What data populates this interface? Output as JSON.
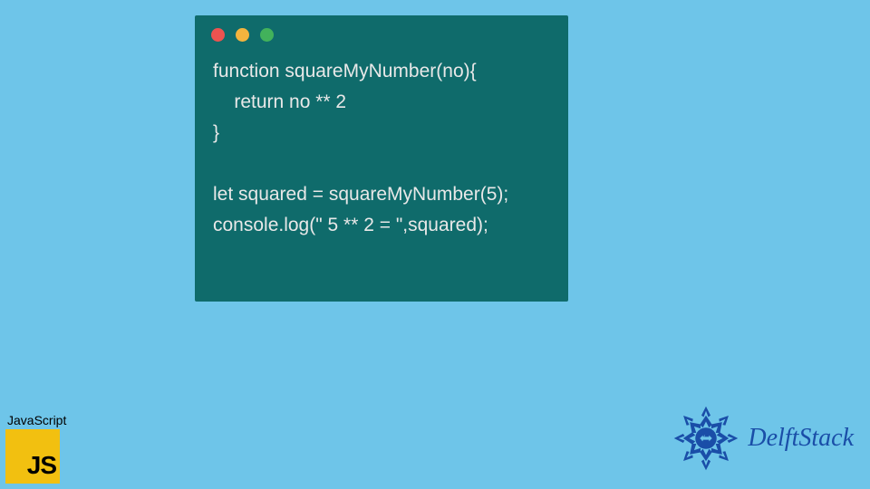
{
  "code": {
    "lines": "function squareMyNumber(no){\n    return no ** 2\n}\n\nlet squared = squareMyNumber(5);\nconsole.log(\" 5 ** 2 = \",squared);"
  },
  "jsBadge": {
    "label": "JavaScript",
    "logoText": "JS"
  },
  "brand": {
    "name": "DelftStack"
  },
  "windowDots": {
    "red": "close-icon",
    "yellow": "minimize-icon",
    "green": "maximize-icon"
  }
}
